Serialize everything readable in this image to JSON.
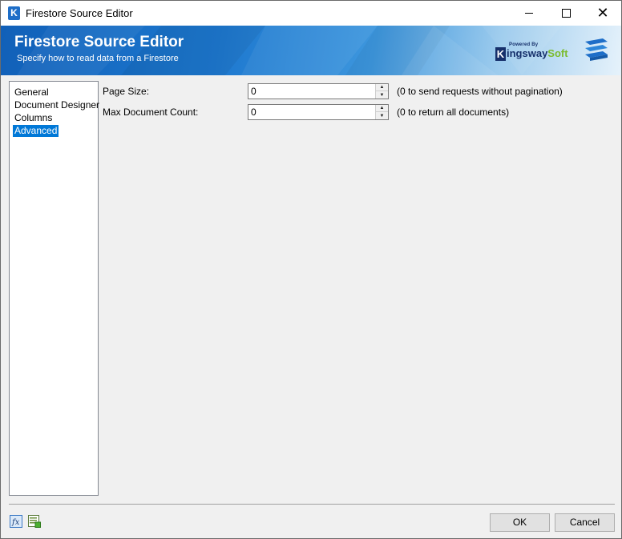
{
  "window": {
    "title": "Firestore Source Editor",
    "icon": "kingswaysoft-k-icon",
    "controls": {
      "minimize": "minimize-icon",
      "maximize": "maximize-icon",
      "close": "close-icon",
      "close_glyph": "✕"
    }
  },
  "banner": {
    "title": "Firestore Source Editor",
    "subtitle": "Specify how to read data from a Firestore",
    "logo": {
      "powered_by": "Powered By",
      "k": "K",
      "word_main": "ingsway",
      "word_soft": "Soft"
    },
    "colors": {
      "start": "#1160b8",
      "end": "#e6f2fb"
    }
  },
  "nav": {
    "items": [
      {
        "label": "General",
        "selected": false
      },
      {
        "label": "Document Designer",
        "selected": false
      },
      {
        "label": "Columns",
        "selected": false
      },
      {
        "label": "Advanced",
        "selected": true
      }
    ]
  },
  "advanced": {
    "page_size": {
      "label": "Page Size:",
      "value": "0",
      "hint": "(0 to send requests without pagination)"
    },
    "max_document_count": {
      "label": "Max Document Count:",
      "value": "0",
      "hint": "(0 to return all documents)"
    }
  },
  "footer": {
    "icons": [
      "expression-fx-icon",
      "variables-icon"
    ],
    "ok_label": "OK",
    "cancel_label": "Cancel"
  },
  "colors": {
    "selection": "#0078d7",
    "logo_blue": "#16306b",
    "logo_green": "#7bbb2e"
  }
}
